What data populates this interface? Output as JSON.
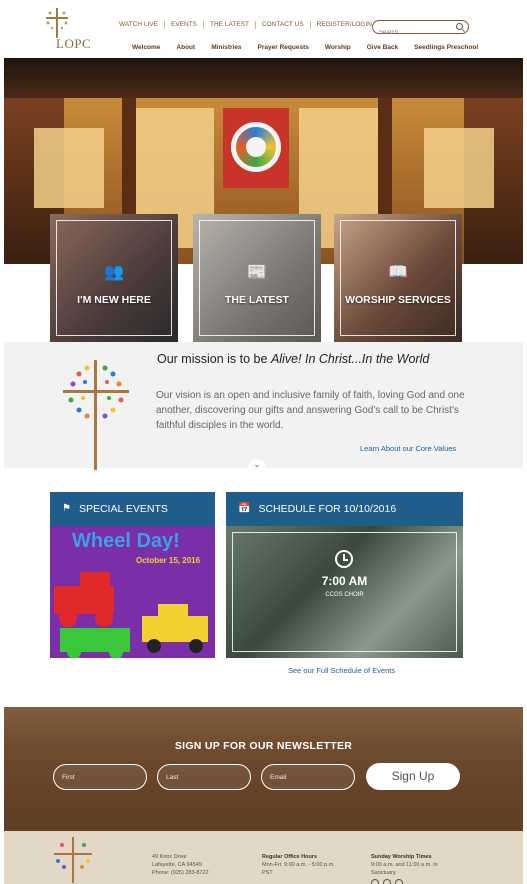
{
  "header": {
    "logo_text": "LOPC",
    "top_nav": [
      "WATCH LIVE",
      "EVENTS",
      "THE LATEST",
      "CONTACT US",
      "REGISTER/LOGIN"
    ],
    "search_placeholder": "Search...",
    "main_nav": [
      "Welcome",
      "About",
      "Ministries",
      "Prayer Requests",
      "Worship",
      "Give Back",
      "Seedlings Preschool"
    ]
  },
  "tiles": [
    {
      "label": "I'M NEW HERE",
      "icon": "people-icon"
    },
    {
      "label": "THE LATEST",
      "icon": "newspaper-icon"
    },
    {
      "label": "WORSHIP SERVICES",
      "icon": "book-icon"
    }
  ],
  "mission": {
    "heading_prefix": "Our mission is to be ",
    "heading_emphasis": "Alive! In Christ...In the World",
    "body": "Our vision is an open and inclusive family of faith, loving God and one another, discovering our gifts and answering God's call to be Christ's faithful disciples in the world.",
    "link": "Learn About our Core Values"
  },
  "special_events": {
    "title": "SPECIAL EVENTS",
    "image_title": "Wheel Day!",
    "image_date": "October 15, 2016"
  },
  "schedule": {
    "title": "SCHEDULE FOR 10/10/2016",
    "time": "7:00 AM",
    "description": "CCGS CHOIR",
    "link": "See our Full Schedule of Events"
  },
  "newsletter": {
    "title": "SIGN UP FOR OUR NEWSLETTER",
    "first_placeholder": "First",
    "last_placeholder": "Last",
    "email_placeholder": "Email",
    "button": "Sign Up"
  },
  "footer": {
    "address_line1": "49 Knox Drive",
    "address_line2": "Lafayette, CA 94549",
    "phone": "Phone: (925) 283-8722",
    "hours_title": "Regular Office Hours",
    "hours_line1": "Mon-Fri: 9:00 a.m. - 5:00 p.m.",
    "hours_line2": "PST",
    "worship_title": "Sunday Worship Times",
    "worship_line1": "9:00 a.m. and 11:00 a.m. in",
    "worship_line2": "Sanctuary"
  },
  "colors": {
    "brand_brown": "#7a5a2f",
    "panel_blue": "#1f5e8a",
    "link_blue": "#1f5e9a",
    "footer_beige": "#e3d7c5"
  }
}
